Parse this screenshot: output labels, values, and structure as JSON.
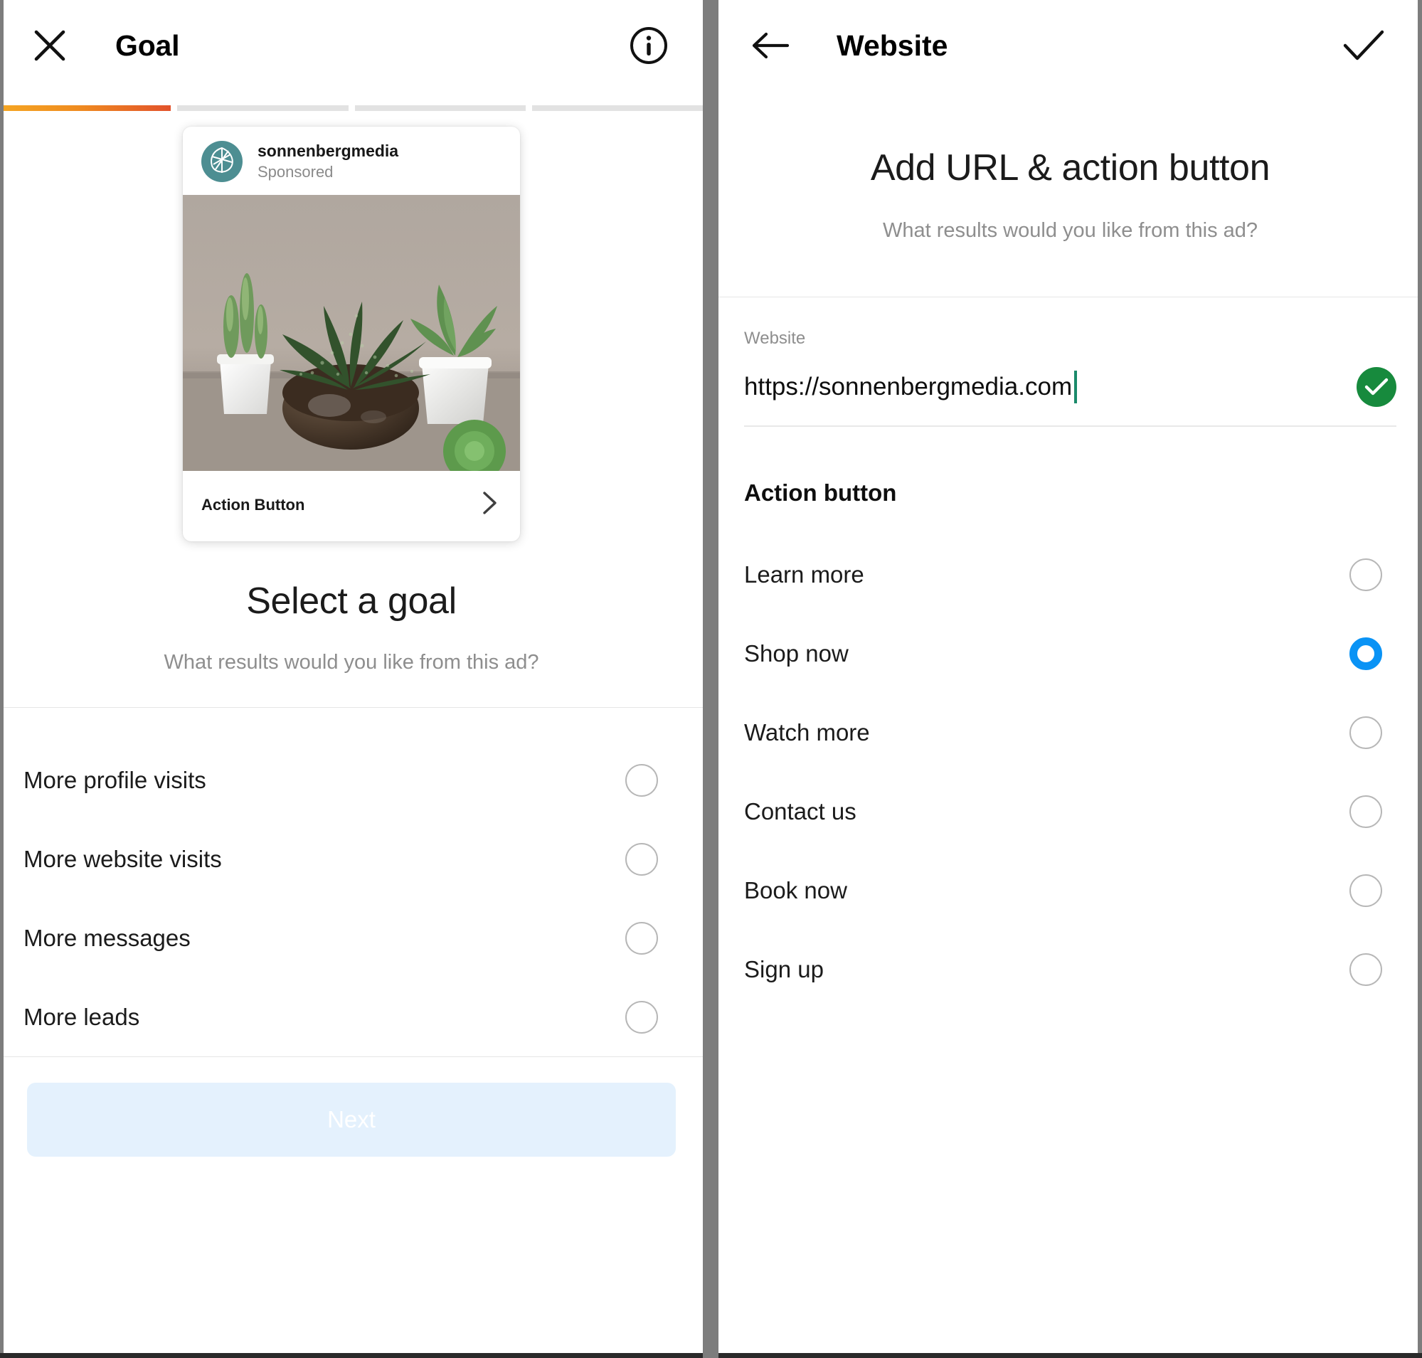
{
  "colors": {
    "accent_orange_start": "#f5a623",
    "accent_orange_end": "#e2522b",
    "instagram_blue": "#0a93f5",
    "success_green": "#178a3d",
    "caret_teal": "#1a8a6a",
    "avatar_teal": "#4d8e92",
    "disabled_button_bg": "#e4f1fd",
    "muted_text": "#8e8e8e",
    "divider": "#e6e6e6"
  },
  "left_panel": {
    "header": {
      "close_icon": "close-icon",
      "title": "Goal",
      "info_icon": "info-circle-icon"
    },
    "progress": {
      "total_steps": 4,
      "current_step": 1
    },
    "ad_preview": {
      "account_handle": "sonnenbergmedia",
      "sponsored_label": "Sponsored",
      "avatar_icon": "leaf-logo-icon",
      "photo_alt": "Potted succulent plants on a table",
      "action_button_label": "Action Button",
      "chevron_icon": "chevron-right-icon"
    },
    "heading": "Select a goal",
    "subheading": "What results would you like from this ad?",
    "goals": [
      {
        "label": "More profile visits",
        "selected": false
      },
      {
        "label": "More website visits",
        "selected": false
      },
      {
        "label": "More messages",
        "selected": false
      },
      {
        "label": "More leads",
        "selected": false
      }
    ],
    "next_button": {
      "label": "Next",
      "enabled": false
    }
  },
  "right_panel": {
    "header": {
      "back_icon": "arrow-left-icon",
      "title": "Website",
      "confirm_icon": "checkmark-icon"
    },
    "heading": "Add URL & action button",
    "subheading": "What results would you like from this ad?",
    "website_field": {
      "label": "Website",
      "value": "https://sonnenbergmedia.com",
      "placeholder": "https://",
      "validated": true,
      "validation_icon": "check-circle-icon",
      "caret_visible": true
    },
    "action_button_section": {
      "title": "Action button",
      "options": [
        {
          "label": "Learn more",
          "selected": false
        },
        {
          "label": "Shop now",
          "selected": true
        },
        {
          "label": "Watch more",
          "selected": false
        },
        {
          "label": "Contact us",
          "selected": false
        },
        {
          "label": "Book now",
          "selected": false
        },
        {
          "label": "Sign up",
          "selected": false
        }
      ]
    }
  }
}
